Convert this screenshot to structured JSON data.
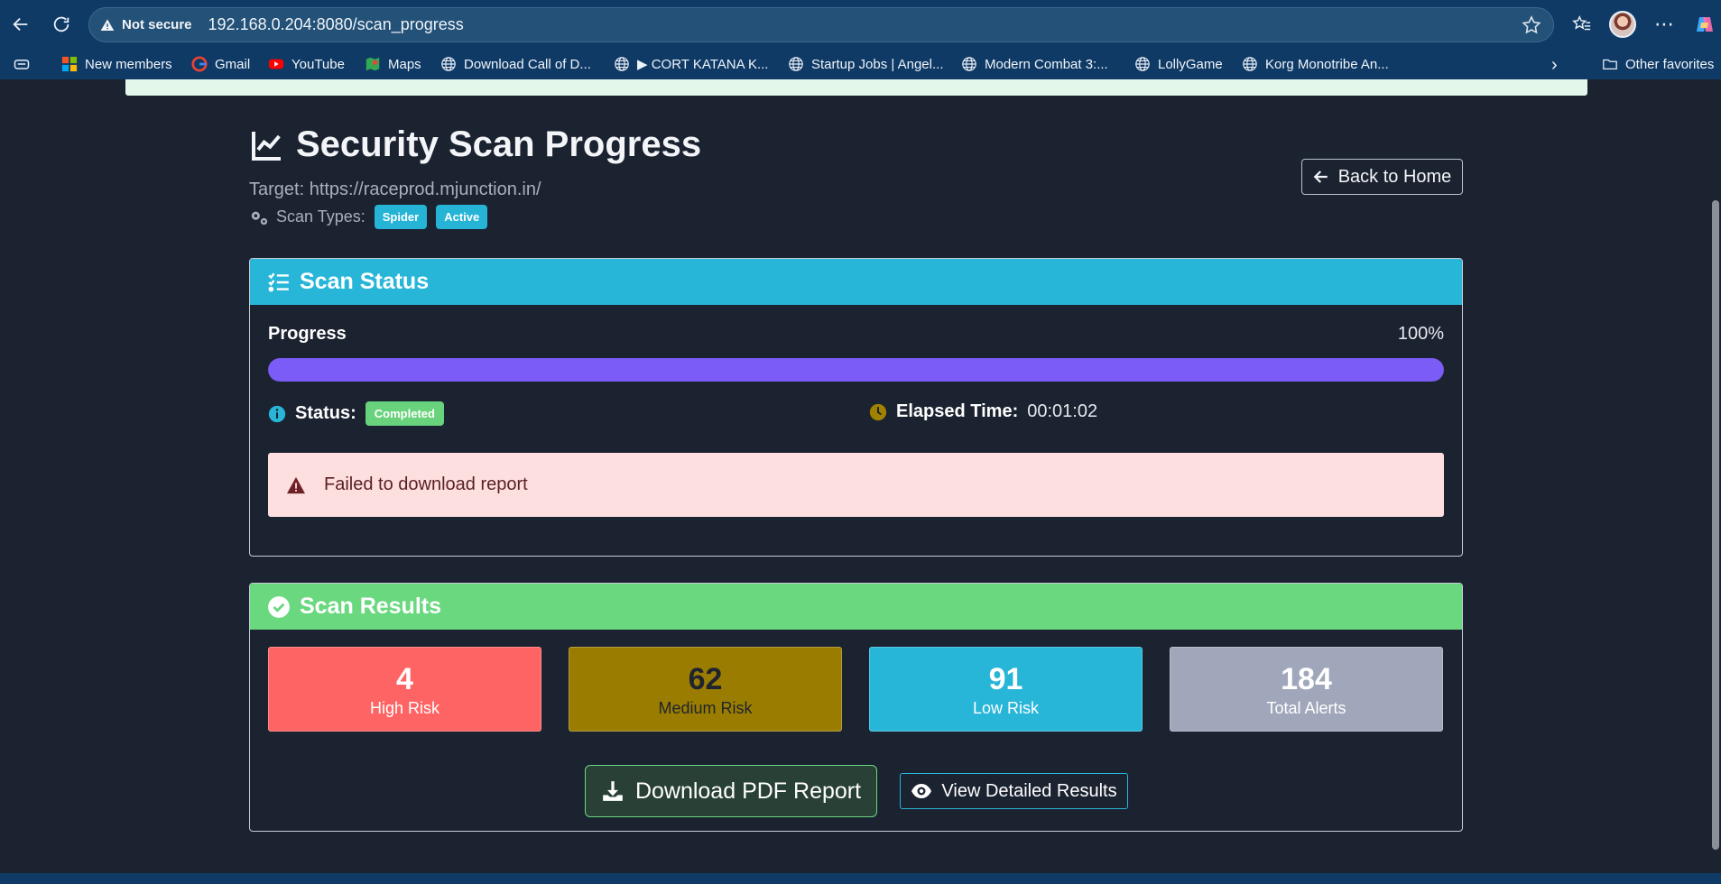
{
  "browser": {
    "security_label": "Not secure",
    "url": "192.168.0.204:8080/scan_progress",
    "bookmarks": [
      {
        "label": "New members",
        "icon": "new-members-icon"
      },
      {
        "label": "Gmail",
        "icon": "google-icon"
      },
      {
        "label": "YouTube",
        "icon": "youtube-icon"
      },
      {
        "label": "Maps",
        "icon": "maps-icon"
      },
      {
        "label": "Download Call of D...",
        "icon": "globe-icon"
      },
      {
        "label": "▶ CORT KATANA K...",
        "icon": "globe-icon"
      },
      {
        "label": "Startup Jobs | Angel...",
        "icon": "globe-icon"
      },
      {
        "label": "Modern Combat 3:...",
        "icon": "globe-icon"
      },
      {
        "label": "LollyGame",
        "icon": "globe-icon"
      },
      {
        "label": "Korg Monotribe An...",
        "icon": "globe-icon"
      }
    ],
    "other_favorites": "Other favorites"
  },
  "page": {
    "title": "Security Scan Progress",
    "target": "Target: https://raceprod.mjunction.in/",
    "scan_types_label": "Scan Types:",
    "scan_types": [
      "Spider",
      "Active"
    ],
    "back_button": "Back to Home"
  },
  "status_card": {
    "header": "Scan Status",
    "progress_label": "Progress",
    "progress_text": "100%",
    "progress_fraction": 1.0,
    "status_label": "Status:",
    "status_value": "Completed",
    "elapsed_label": "Elapsed Time:",
    "elapsed_value": "00:01:02",
    "error_message": "Failed to download report"
  },
  "results_card": {
    "header": "Scan Results",
    "stats": [
      {
        "value": "4",
        "label": "High Risk"
      },
      {
        "value": "62",
        "label": "Medium Risk"
      },
      {
        "value": "91",
        "label": "Low Risk"
      },
      {
        "value": "184",
        "label": "Total Alerts"
      }
    ],
    "download_button": "Download PDF Report",
    "view_button": "View Detailed Results"
  },
  "colors": {
    "status_header": "#27b6d8",
    "results_header": "#6ad87f",
    "progress_fill": "#7b5cf6",
    "high": "#ff6464",
    "medium": "#9a7d00",
    "low": "#28b6d8",
    "total": "#a0a7ba"
  }
}
